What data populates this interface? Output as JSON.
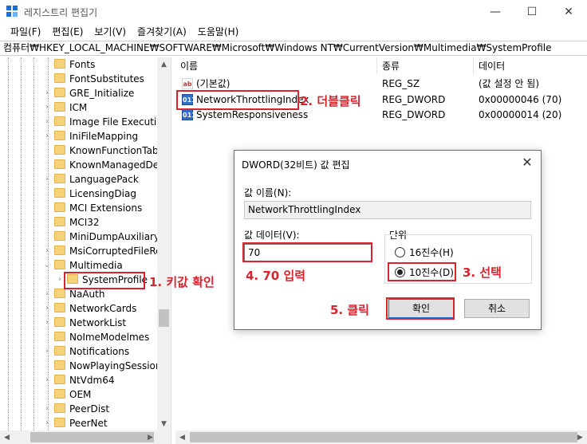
{
  "window": {
    "title": "레지스트리 편집기",
    "minimize_glyph": "—",
    "maximize_glyph": "☐",
    "close_glyph": "✕"
  },
  "menu": [
    "파일(F)",
    "편집(E)",
    "보기(V)",
    "즐겨찾기(A)",
    "도움말(H)"
  ],
  "address": "컴퓨터₩HKEY_LOCAL_MACHINE₩SOFTWARE₩Microsoft₩Windows NT₩CurrentVersion₩Multimedia₩SystemProfile",
  "tree": {
    "items": [
      {
        "label": "Fonts",
        "chevron": ""
      },
      {
        "label": "FontSubstitutes",
        "chevron": ""
      },
      {
        "label": "GRE_Initialize",
        "chevron": "›"
      },
      {
        "label": "ICM",
        "chevron": "›"
      },
      {
        "label": "Image File Execution",
        "chevron": "›"
      },
      {
        "label": "IniFileMapping",
        "chevron": "›"
      },
      {
        "label": "KnownFunctionTable",
        "chevron": ""
      },
      {
        "label": "KnownManagedDeb",
        "chevron": ""
      },
      {
        "label": "LanguagePack",
        "chevron": "›"
      },
      {
        "label": "LicensingDiag",
        "chevron": ""
      },
      {
        "label": "MCI Extensions",
        "chevron": ""
      },
      {
        "label": "MCI32",
        "chevron": ""
      },
      {
        "label": "MiniDumpAuxiliaryD",
        "chevron": ""
      },
      {
        "label": "MsiCorruptedFileRec",
        "chevron": "›"
      },
      {
        "label": "Multimedia",
        "chevron": "⌄"
      },
      {
        "label": "SystemProfile",
        "chevron": "›"
      },
      {
        "label": "NaAuth",
        "chevron": "›"
      },
      {
        "label": "NetworkCards",
        "chevron": "›"
      },
      {
        "label": "NetworkList",
        "chevron": "›"
      },
      {
        "label": "NoImeModelmes",
        "chevron": ""
      },
      {
        "label": "Notifications",
        "chevron": "›"
      },
      {
        "label": "NowPlayingSessionM",
        "chevron": ""
      },
      {
        "label": "NtVdm64",
        "chevron": "›"
      },
      {
        "label": "OEM",
        "chevron": ""
      },
      {
        "label": "PeerDist",
        "chevron": "›"
      },
      {
        "label": "PeerNet",
        "chevron": "›"
      }
    ]
  },
  "list": {
    "headers": [
      "이름",
      "종류",
      "데이터"
    ],
    "rows": [
      {
        "icon": "ab",
        "name": "(기본값)",
        "type": "REG_SZ",
        "data": "(값 설정 안 됨)"
      },
      {
        "icon": "011",
        "name": "NetworkThrottlingIndex",
        "type": "REG_DWORD",
        "data": "0x00000046 (70)"
      },
      {
        "icon": "011",
        "name": "SystemResponsiveness",
        "type": "REG_DWORD",
        "data": "0x00000014 (20)"
      }
    ]
  },
  "dialog": {
    "title": "DWORD(32비트) 값 편집",
    "close_glyph": "✕",
    "name_label": "값 이름(N):",
    "name_value": "NetworkThrottlingIndex",
    "data_label": "값 데이터(V):",
    "data_value": "70",
    "base_label": "단위",
    "hex_label": "16진수(H)",
    "dec_label": "10진수(D)",
    "ok_label": "확인",
    "cancel_label": "취소"
  },
  "annotations": {
    "step1": "1. 키값 확인",
    "step2": "2. 더블클릭",
    "step3": "3. 선택",
    "step4": "4. 70 입력",
    "step5": "5. 클릭"
  },
  "colors": {
    "annotation_red": "#d9232d",
    "folder_yellow": "#f6d37a",
    "dword_icon_blue": "#2f6fc7",
    "default_button_border": "#0078d7"
  }
}
